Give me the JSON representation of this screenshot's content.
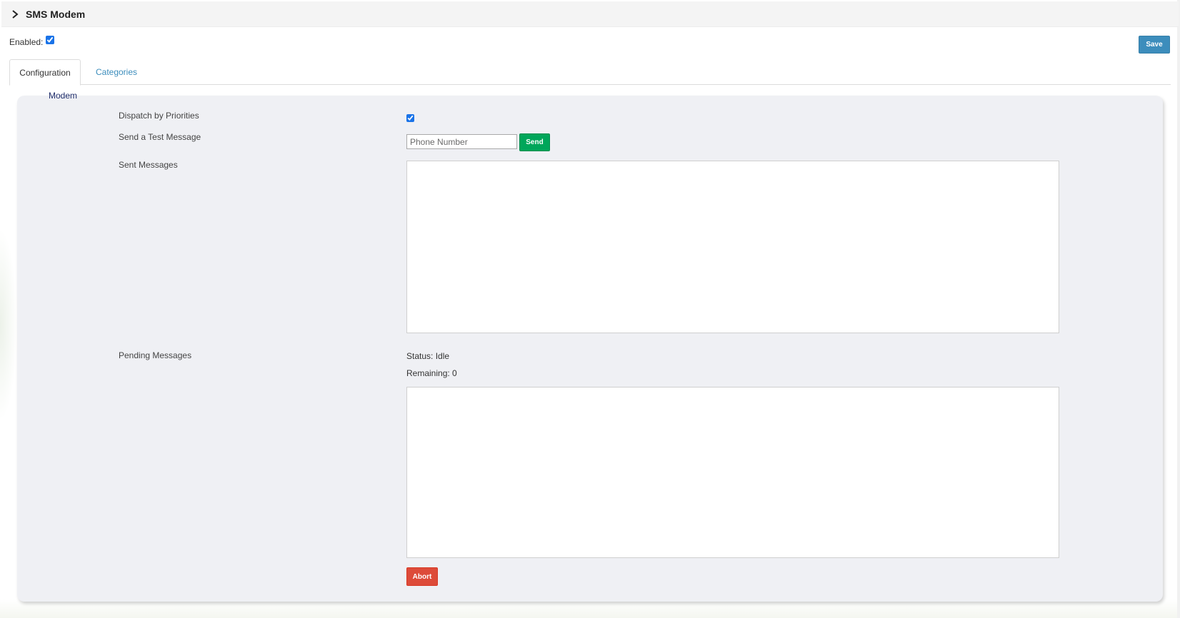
{
  "header": {
    "title": "SMS Modem",
    "toggle_icon": "chevron-right-icon"
  },
  "enabled": {
    "label": "Enabled:",
    "checked": true
  },
  "toolbar": {
    "save_label": "Save"
  },
  "tabs": [
    {
      "label": "Configuration",
      "active": true
    },
    {
      "label": "Categories",
      "active": false
    }
  ],
  "section": {
    "legend": "Modem"
  },
  "fields": {
    "dispatch_label": "Dispatch by Priorities",
    "dispatch_checked": true,
    "test_label": "Send a Test Message",
    "phone_placeholder": "Phone Number",
    "send_label": "Send",
    "sent_label": "Sent Messages",
    "pending_label": "Pending Messages",
    "status_text": "Status: Idle",
    "remaining_text": "Remaining: 0",
    "abort_label": "Abort"
  },
  "colors": {
    "save": "#3c8dbc",
    "send": "#00a65a",
    "abort": "#dd4b39",
    "tab_link": "#3c8dbc",
    "panel": "#eff0f4"
  }
}
